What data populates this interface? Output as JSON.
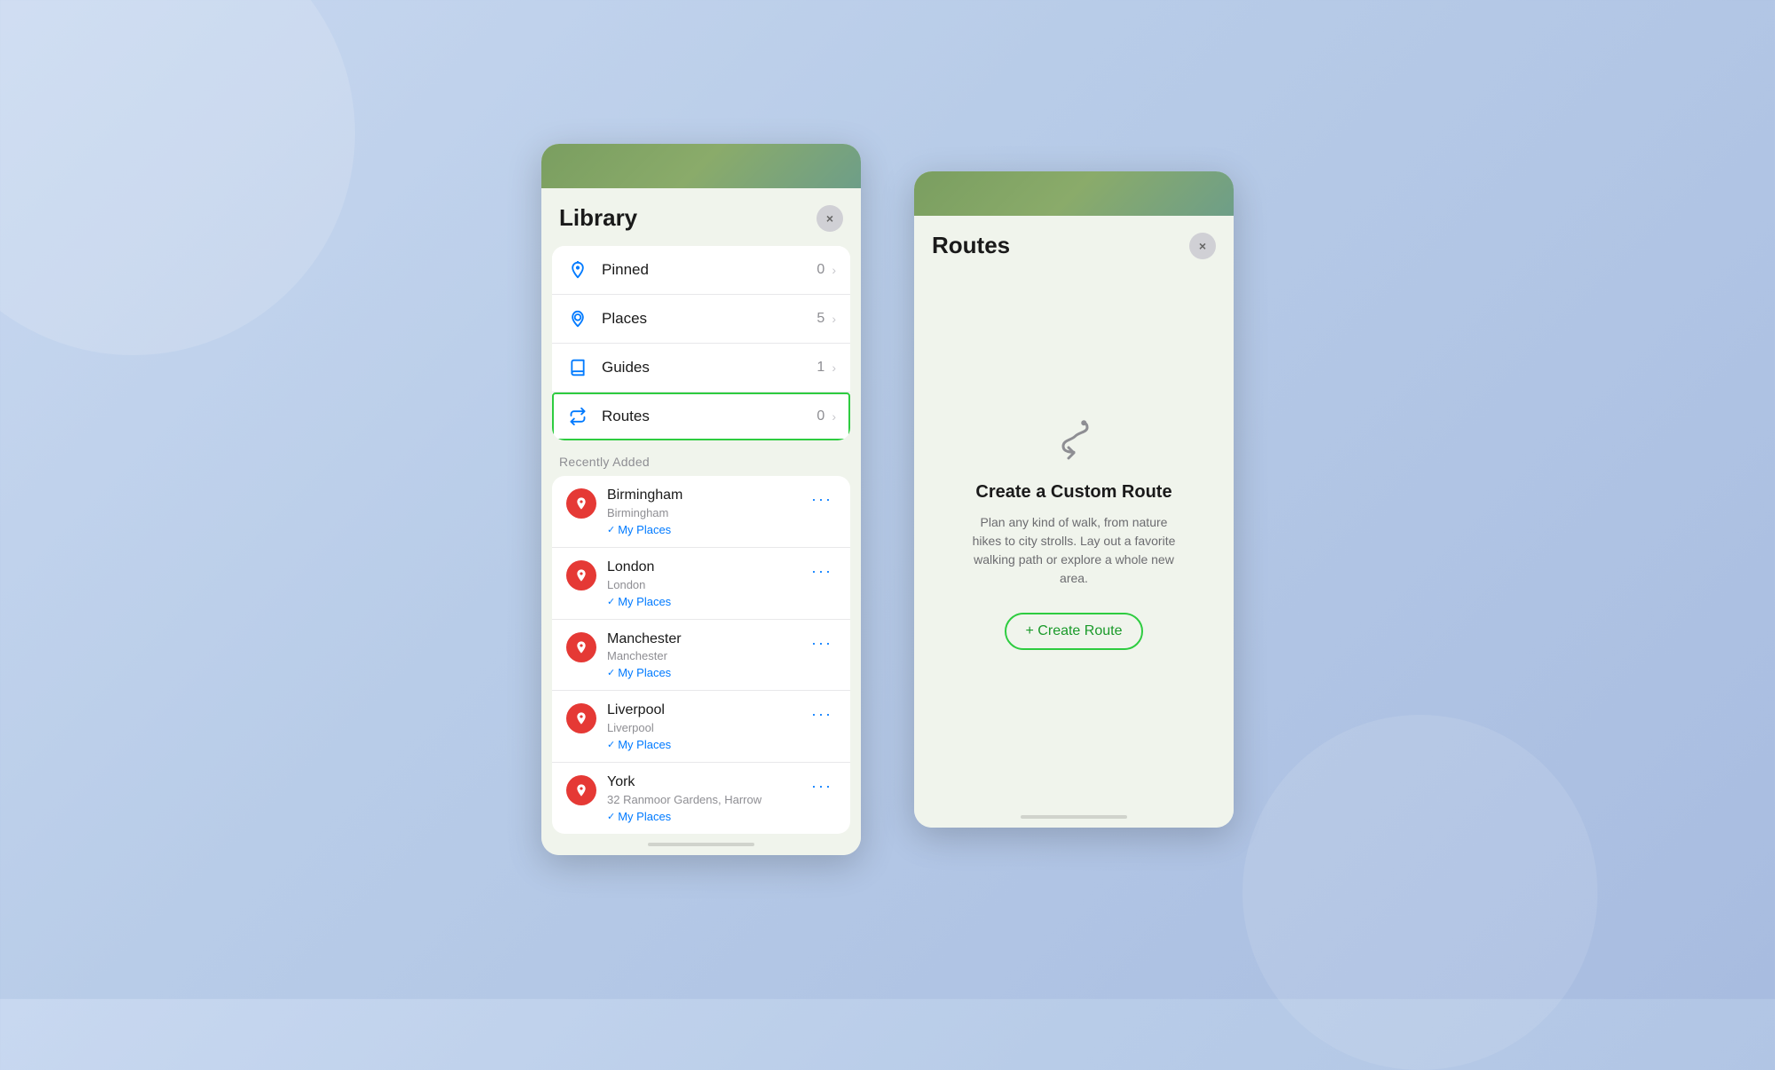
{
  "library": {
    "title": "Library",
    "close_label": "×",
    "nav_items": [
      {
        "id": "pinned",
        "icon": "📌",
        "label": "Pinned",
        "count": "0"
      },
      {
        "id": "places",
        "icon": "📍",
        "label": "Places",
        "count": "5"
      },
      {
        "id": "guides",
        "icon": "📖",
        "label": "Guides",
        "count": "1"
      },
      {
        "id": "routes",
        "icon": "🔀",
        "label": "Routes",
        "count": "0",
        "active": true
      }
    ],
    "recently_added_label": "Recently Added",
    "places": [
      {
        "name": "Birmingham",
        "subtitle": "Birmingham",
        "tag": "My Places"
      },
      {
        "name": "London",
        "subtitle": "London",
        "tag": "My Places"
      },
      {
        "name": "Manchester",
        "subtitle": "Manchester",
        "tag": "My Places"
      },
      {
        "name": "Liverpool",
        "subtitle": "Liverpool",
        "tag": "My Places"
      },
      {
        "name": "York",
        "subtitle": "32 Ranmoor Gardens, Harrow",
        "tag": "My Places"
      }
    ]
  },
  "routes": {
    "title": "Routes",
    "close_label": "×",
    "empty_title": "Create a Custom Route",
    "empty_description": "Plan any kind of walk, from nature hikes to city strolls. Lay out a favorite walking path or explore a whole new area.",
    "create_button_label": "+ Create Route"
  },
  "colors": {
    "accent_green": "#2ecc40",
    "blue": "#007aff",
    "red": "#e53935",
    "active_border": "#2ecc40"
  }
}
